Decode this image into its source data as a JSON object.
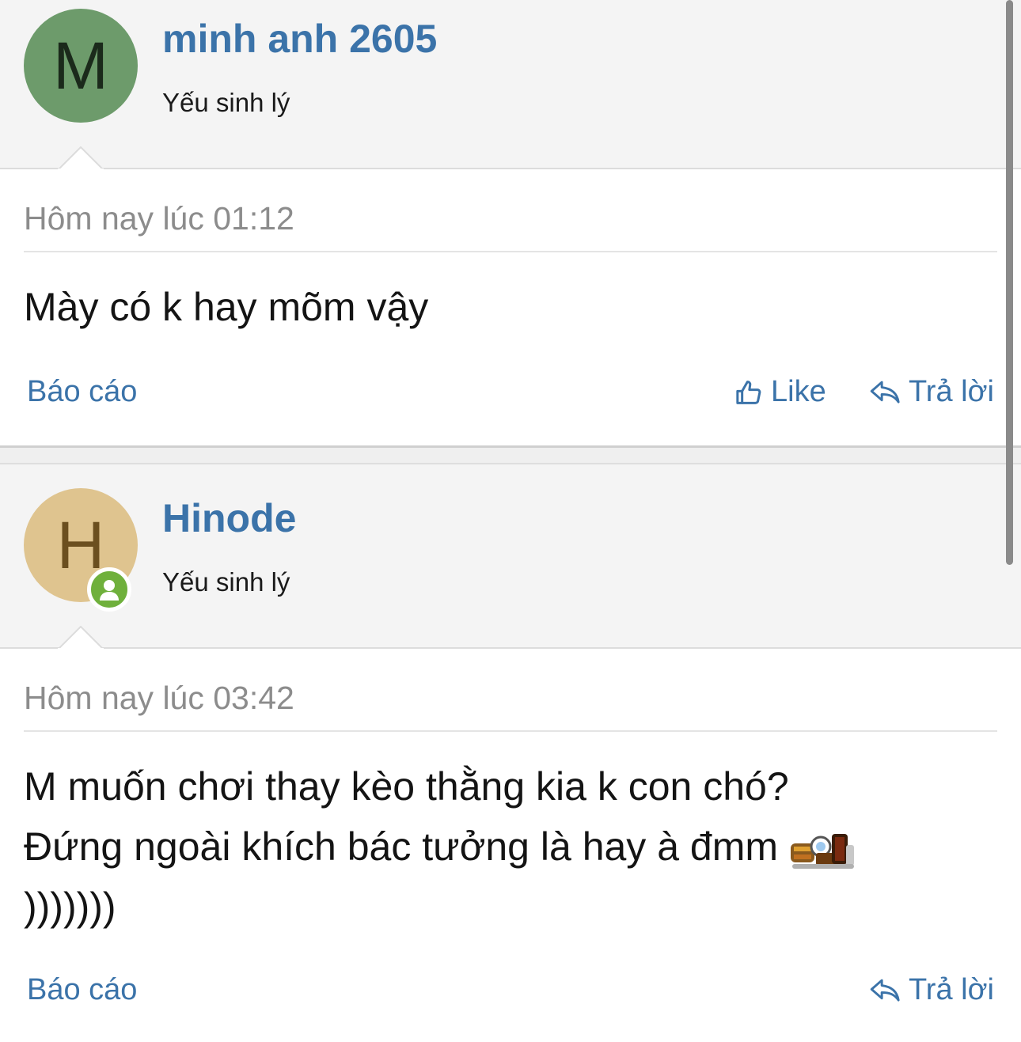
{
  "posts": [
    {
      "avatar_letter": "M",
      "avatar_bg": "#6d9b6b",
      "avatar_fg": "#1b2a1b",
      "username": "minh anh 2605",
      "user_title": "Yếu sinh lý",
      "timestamp": "Hôm nay lúc 01:12",
      "message": "Mày có k hay mõm vậy",
      "report_label": "Báo cáo",
      "like_label": "Like",
      "reply_label": "Trả lời"
    },
    {
      "avatar_letter": "H",
      "avatar_bg": "#dfc48f",
      "avatar_fg": "#6b4f1f",
      "online_icon": "online-user-icon",
      "username": "Hinode",
      "user_title": "Yếu sinh lý",
      "timestamp": "Hôm nay lúc 03:42",
      "message_line1": "M muốn chơi thay kèo thằng kia k con chó?",
      "message_line2": "Đứng ngoài khích bác tưởng là hay à đmm",
      "message_line3": ")))))))",
      "emoji_icon": "pixel-emoji-icon",
      "report_label": "Báo cáo",
      "reply_label": "Trả lời"
    }
  ],
  "colors": {
    "link": "#3b73a9",
    "header_bg": "#f4f4f4",
    "online": "#6fb03c"
  }
}
